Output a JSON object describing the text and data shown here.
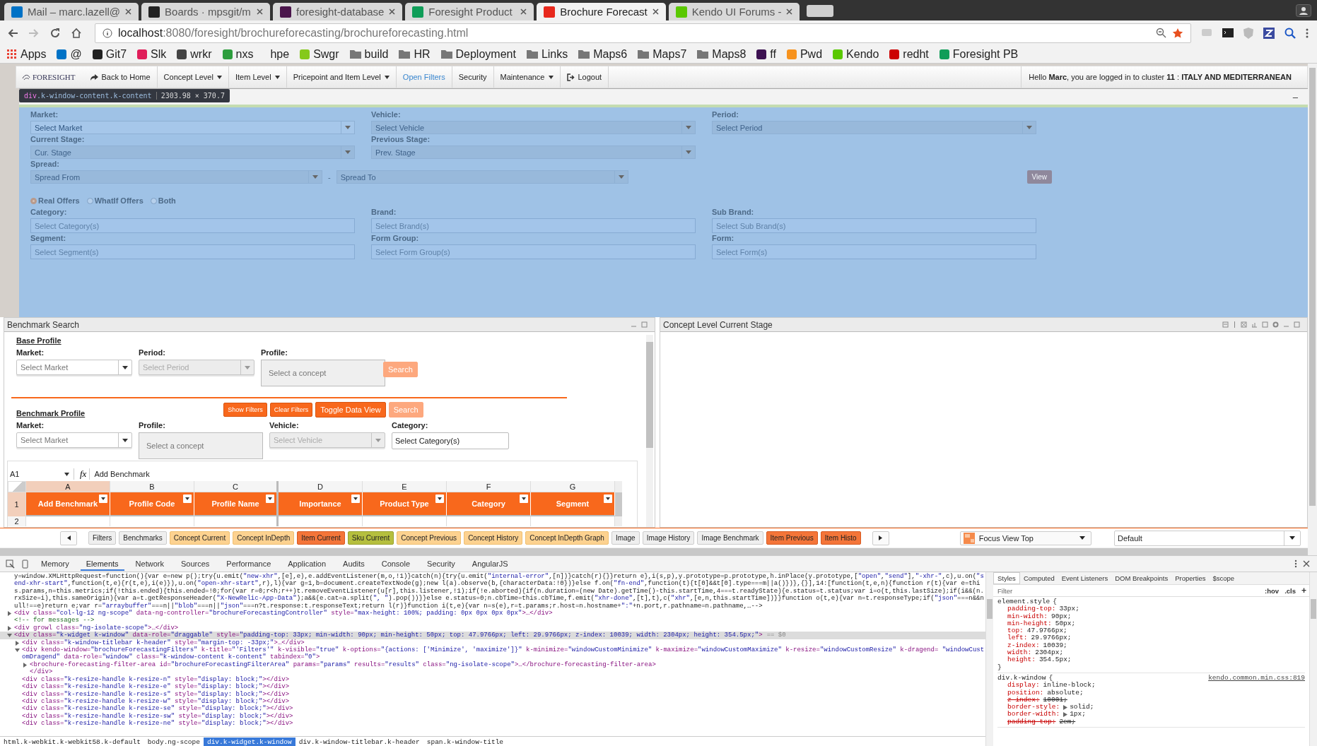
{
  "browser": {
    "tabs": [
      {
        "title": "Mail – marc.lazell@",
        "color": "#0072c6",
        "selected": false
      },
      {
        "title": "Boards · mpsgit/m",
        "color": "#222222",
        "selected": false
      },
      {
        "title": "foresight-database",
        "color": "#4a154b",
        "selected": false
      },
      {
        "title": "Foresight Product",
        "color": "#0f9d58",
        "selected": false
      },
      {
        "title": "Brochure Forecast",
        "color": "#e8281c",
        "selected": true
      },
      {
        "title": "Kendo UI Forums -",
        "color": "#5ac800",
        "selected": false
      }
    ],
    "url_host": "localhost",
    "url_path": ":8080/foresight/brochureforecasting/brochureforecasting.html",
    "bookmarks": [
      {
        "label": "Apps",
        "kind": "grid",
        "color": "#e94235"
      },
      {
        "label": "@",
        "kind": "site",
        "color": "#0072c6"
      },
      {
        "label": "Git7",
        "kind": "site",
        "color": "#222222"
      },
      {
        "label": "Slk",
        "kind": "site",
        "color": "#e01e5a"
      },
      {
        "label": "wrkr",
        "kind": "site",
        "color": "#444444"
      },
      {
        "label": "nxs",
        "kind": "site",
        "color": "#2e9e3e"
      },
      {
        "label": "hpe",
        "kind": "plain"
      },
      {
        "label": "Swgr",
        "kind": "site",
        "color": "#85c91b"
      },
      {
        "label": "build",
        "kind": "folder",
        "color": "#777777"
      },
      {
        "label": "HR",
        "kind": "folder",
        "color": "#777777"
      },
      {
        "label": "Deployment",
        "kind": "folder",
        "color": "#777777"
      },
      {
        "label": "Links",
        "kind": "folder",
        "color": "#777777"
      },
      {
        "label": "Maps6",
        "kind": "folder",
        "color": "#777777"
      },
      {
        "label": "Maps7",
        "kind": "folder",
        "color": "#777777"
      },
      {
        "label": "Maps8",
        "kind": "folder",
        "color": "#777777"
      },
      {
        "label": "ff",
        "kind": "site",
        "color": "#3d1252"
      },
      {
        "label": "Pwd",
        "kind": "site",
        "color": "#f7931e"
      },
      {
        "label": "Kendo",
        "kind": "site",
        "color": "#5ac800"
      },
      {
        "label": "redht",
        "kind": "site",
        "color": "#cc0000"
      },
      {
        "label": "Foresight PB",
        "kind": "site",
        "color": "#0f9d58"
      }
    ]
  },
  "nav": {
    "logo": "FORESIGHT",
    "items": [
      {
        "label": "Back to Home",
        "kind": "back"
      },
      {
        "label": "Concept Level",
        "kind": "menu"
      },
      {
        "label": "Item Level",
        "kind": "menu"
      },
      {
        "label": "Pricepoint and Item Level",
        "kind": "menu"
      },
      {
        "label": "Open Filters",
        "kind": "link"
      },
      {
        "label": "Security",
        "kind": "plain"
      },
      {
        "label": "Maintenance",
        "kind": "menu"
      },
      {
        "label": "Logout",
        "kind": "logout"
      }
    ],
    "greeting": "Hello **Marc**, you are logged in to cluster **11** : **ITALY AND MEDITERRANEAN**"
  },
  "inspect_tooltip": {
    "tag": "div",
    "classes": ".k-window-content.k-content",
    "size": "2303.98 × 370.7"
  },
  "filters": {
    "minimize": "–",
    "dropdowns": [
      {
        "label": "Market:",
        "placeholder": "Select Market",
        "disabled": false
      },
      {
        "label": "Vehicle:",
        "placeholder": "Select Vehicle",
        "disabled": true
      },
      {
        "label": "Period:",
        "placeholder": "Select Period",
        "disabled": true
      },
      {
        "label": "Current Stage:",
        "placeholder": "Cur. Stage",
        "disabled": true
      },
      {
        "label": "Previous Stage:",
        "placeholder": "Prev. Stage",
        "disabled": true
      }
    ],
    "spread": {
      "label": "Spread:",
      "from": "Spread From",
      "separator": "-",
      "to": "Spread To",
      "disabled": true
    },
    "view_button": "View",
    "offer_types": [
      {
        "label": "Real Offers",
        "selected": true
      },
      {
        "label": "WhatIf Offers",
        "selected": false
      },
      {
        "label": "Both",
        "selected": false
      }
    ],
    "multiselects": [
      {
        "label": "Category:",
        "placeholder": "Select Category(s)"
      },
      {
        "label": "Brand:",
        "placeholder": "Select Brand(s)"
      },
      {
        "label": "Sub Brand:",
        "placeholder": "Select Sub Brand(s)"
      },
      {
        "label": "Segment:",
        "placeholder": "Select Segment(s)"
      },
      {
        "label": "Form Group:",
        "placeholder": "Select Form Group(s)"
      },
      {
        "label": "Form:",
        "placeholder": "Select Form(s)"
      }
    ]
  },
  "benchmark": {
    "title": "Benchmark Search",
    "base_profile": {
      "heading": "Base Profile",
      "fields": [
        {
          "label": "Market:",
          "placeholder": "Select Market",
          "kind": "dropdown",
          "disabled": false
        },
        {
          "label": "Period:",
          "placeholder": "Select Period",
          "kind": "dropdown",
          "disabled": true
        },
        {
          "label": "Profile:",
          "placeholder": "Select a concept",
          "kind": "concept"
        }
      ],
      "search": {
        "label": "Search",
        "disabled": true
      }
    },
    "benchmark_profile": {
      "heading": "Benchmark Profile",
      "buttons": [
        {
          "label": "Show Filters",
          "kind": "small",
          "disabled": false
        },
        {
          "label": "Clear Filters",
          "kind": "small",
          "disabled": false
        },
        {
          "label": "Toggle Data View",
          "kind": "large",
          "disabled": false
        },
        {
          "label": "Search",
          "kind": "large",
          "disabled": true
        }
      ],
      "fields": [
        {
          "label": "Market:",
          "placeholder": "Select Market",
          "kind": "dropdown",
          "disabled": false
        },
        {
          "label": "Profile:",
          "placeholder": "Select a concept",
          "kind": "concept"
        },
        {
          "label": "Vehicle:",
          "placeholder": "Select Vehicle",
          "kind": "dropdown",
          "disabled": true
        },
        {
          "label": "Category:",
          "placeholder": "Select Category(s)",
          "kind": "multi"
        }
      ]
    },
    "sheet": {
      "cell_ref": "A1",
      "fx": "fx",
      "formula": "Add Benchmark",
      "columns": [
        {
          "label": "A",
          "selected": true
        },
        {
          "label": "B",
          "selected": false
        },
        {
          "label": "C",
          "selected": false
        },
        {
          "label": "D",
          "selected": false
        },
        {
          "label": "E",
          "selected": false
        },
        {
          "label": "F",
          "selected": false
        },
        {
          "label": "G",
          "selected": false
        }
      ],
      "header_row": "1",
      "headers": [
        "Add Benchmark",
        "Profile Code",
        "Profile Name",
        "Importance",
        "Product Type",
        "Category",
        "Segment"
      ],
      "next_row": "2"
    }
  },
  "concept_panel": {
    "title": "Concept Level Current Stage"
  },
  "bottom_bar": {
    "tabs": [
      {
        "label": "Filters",
        "kind": "plain"
      },
      {
        "label": "Benchmarks",
        "kind": "plain"
      },
      {
        "label": "Concept Current",
        "kind": "concept"
      },
      {
        "label": "Concept InDepth",
        "kind": "concept"
      },
      {
        "label": "Item Current",
        "kind": "item"
      },
      {
        "label": "Sku Current",
        "kind": "sku"
      },
      {
        "label": "Concept Previous",
        "kind": "concept"
      },
      {
        "label": "Concept History",
        "kind": "concept"
      },
      {
        "label": "Concept InDepth Graph",
        "kind": "concept"
      },
      {
        "label": "Image",
        "kind": "plain"
      },
      {
        "label": "Image History",
        "kind": "plain"
      },
      {
        "label": "Image Benchmark",
        "kind": "plain"
      },
      {
        "label": "Item Previous",
        "kind": "item"
      },
      {
        "label": "Item Histo",
        "kind": "item"
      }
    ],
    "focus_view": "Focus View Top",
    "layout": "Default"
  },
  "devtools": {
    "tabs": [
      {
        "label": "Memory",
        "selected": false
      },
      {
        "label": "Elements",
        "selected": true
      },
      {
        "label": "Network",
        "selected": false
      },
      {
        "label": "Sources",
        "selected": false
      },
      {
        "label": "Performance",
        "selected": false
      },
      {
        "label": "Application",
        "selected": false
      },
      {
        "label": "Audits",
        "selected": false
      },
      {
        "label": "Console",
        "selected": false
      },
      {
        "label": "Security",
        "selected": false
      },
      {
        "label": "AngularJS",
        "selected": false
      }
    ],
    "dom_tree": [
      {
        "kind": "script",
        "selected": false,
        "text": "y=window.XMLHttpRequest=function(){var e=new p();try{u.emit(\"new-xhr\",[e],e),e.addEventListener(m,o,!1)}catch(n){try{u.emit(\"internal-error\",[n])}catch(r){}}return e},i(s,p),y.prototype=p.prototype,h.inPlace(y.prototype,[\"open\",\"send\"],\"-xhr-\",c),u.on(\"send-xhr-start\",function(t,e){r(t,e),i(e)}),u.on(\"open-xhr-start\",r),l){var g=1,b=document.createTextNode(g);new l(a).observe(b,{characterData:!0})}else f.on(\"fn-end\",function(t){t[0]&&t[0].type===m||a()})},{}],14:[function(t,e,n){function r(t){var e=this.params,n=this.metrics;if(!this.ended){this.ended=!0;for(var r=0;r<h;r++)t.removeEventListener(u[r],this.listener,!1);if(!e.aborted){if(n.duration=(new Date).getTime()-this.startTime,4===t.readyState){e.status=t.status;var i=o(t,this.lastSize);if(i&&(n.rxSize=i),this.sameOrigin){var a=t.getResponseHeader(\"X-NewRelic-App-Data\");a&&(e.cat=a.split(\", \").pop())}}else e.status=0;n.cbTime=this.cbTime,f.emit(\"xhr-done\",[t],t),c(\"xhr\",[e,n,this.startTime])}}function o(t,e){var n=t.responseType;if(\"json\"===n&&null!==e)return e;var r=\"arraybuffer\"===n||\"blob\"===n||\"json\"===n?t.response:t.responseText;return l(r)}function i(t,e){var n=s(e),r=t.params;r.host=n.hostname+\":\"+n.port,r.pathname=n.pathname,…-->"
      },
      {
        "kind": "element",
        "selected": false,
        "expanded": false,
        "text": "<div class=\"col-lg-12 ng-scope\" data-ng-controller=\"brochureForecastingController\" style=\"max-height: 100%; padding: 0px 0px 0px 0px\">…</div>"
      },
      {
        "kind": "comment",
        "selected": false,
        "text": "<!-- for messages -->"
      },
      {
        "kind": "element",
        "selected": false,
        "expanded": false,
        "text": "<div growl class=\"ng-isolate-scope\">…</div>"
      },
      {
        "kind": "element",
        "selected": true,
        "expanded": true,
        "marker": "== $0",
        "text": "<div class=\"k-widget k-window\" data-role=\"draggable\" style=\"padding-top: 33px; min-width: 90px; min-height: 50px; top: 47.9766px; left: 29.9766px; z-index: 10039; width: 2304px; height: 354.5px;\">",
        "children": [
          {
            "kind": "element",
            "selected": false,
            "expanded": false,
            "text": "<div class=\"k-window-titlebar k-header\" style=\"margin-top: -33px;\">…</div>"
          },
          {
            "kind": "element",
            "selected": false,
            "expanded": true,
            "text": "<div kendo-window=\"brochureForecastingFilters\" k-title=\"'Filters'\" k-visible=\"true\" k-options=\"{actions: ['Minimize', 'maximize']}\" k-minimize=\"windowCustomMinimize\" k-maximize=\"windowCustomMaximize\" k-resize=\"windowCustomResize\" k-dragend= \"windowCustomDragend\" data-role=\"window\" class=\"k-window-content k-content\" tabindex=\"0\">",
            "children": [
              {
                "kind": "element",
                "selected": false,
                "expanded": false,
                "text": "<brochure-forecasting-filter-area id=\"brochureForecastingFilterArea\" params=\"params\" results=\"results\" class=\"ng-isolate-scope\">…</brochure-forecasting-filter-area>"
              },
              {
                "kind": "element",
                "selected": false,
                "text": "</div>"
              }
            ]
          },
          {
            "kind": "element",
            "selected": false,
            "text": "<div class=\"k-resize-handle k-resize-n\" style=\"display: block;\"></div>"
          },
          {
            "kind": "element",
            "selected": false,
            "text": "<div class=\"k-resize-handle k-resize-e\" style=\"display: block;\"></div>"
          },
          {
            "kind": "element",
            "selected": false,
            "text": "<div class=\"k-resize-handle k-resize-s\" style=\"display: block;\"></div>"
          },
          {
            "kind": "element",
            "selected": false,
            "text": "<div class=\"k-resize-handle k-resize-w\" style=\"display: block;\"></div>"
          },
          {
            "kind": "element",
            "selected": false,
            "text": "<div class=\"k-resize-handle k-resize-se\" style=\"display: block;\"></div>"
          },
          {
            "kind": "element",
            "selected": false,
            "text": "<div class=\"k-resize-handle k-resize-sw\" style=\"display: block;\"></div>"
          },
          {
            "kind": "element",
            "selected": false,
            "text": "<div class=\"k-resize-handle k-resize-ne\" style=\"display: block;\"></div>"
          }
        ]
      }
    ],
    "breadcrumbs": [
      {
        "label": "html.k-webkit.k-webkit58.k-default",
        "selected": false
      },
      {
        "label": "body.ng-scope",
        "selected": false
      },
      {
        "label": "div.k-widget.k-window",
        "selected": true
      },
      {
        "label": "div.k-window-titlebar.k-header",
        "selected": false
      },
      {
        "label": "span.k-window-title",
        "selected": false
      }
    ],
    "styles": {
      "tabs": [
        {
          "label": "Styles",
          "selected": true
        },
        {
          "label": "Computed",
          "selected": false
        },
        {
          "label": "Event Listeners",
          "selected": false
        },
        {
          "label": "DOM Breakpoints",
          "selected": false
        },
        {
          "label": "Properties",
          "selected": false
        },
        {
          "label": "$scope",
          "selected": false
        }
      ],
      "filter_placeholder": "Filter",
      "hov": ":hov",
      "cls": ".cls",
      "add": "+",
      "rules": [
        {
          "selector": "element.style",
          "open": "{",
          "close": "}",
          "props": [
            {
              "name": "padding-top:",
              "value": "33px;",
              "struck": false
            },
            {
              "name": "min-width:",
              "value": "90px;",
              "struck": false
            },
            {
              "name": "min-height:",
              "value": "50px;",
              "struck": false
            },
            {
              "name": "top:",
              "value": "47.9766px;",
              "struck": false
            },
            {
              "name": "left:",
              "value": "29.9766px;",
              "struck": false
            },
            {
              "name": "z-index:",
              "value": "10039;",
              "struck": false
            },
            {
              "name": "width:",
              "value": "2304px;",
              "struck": false
            },
            {
              "name": "height:",
              "value": "354.5px;",
              "struck": false
            }
          ]
        },
        {
          "selector": "div.k-window",
          "source": "kendo.common.min.css:819",
          "open": "{",
          "props": [
            {
              "name": "display:",
              "value": "inline-block;",
              "struck": false
            },
            {
              "name": "position:",
              "value": "absolute;",
              "struck": false
            },
            {
              "name": "z-index:",
              "value": "10001;",
              "struck": true
            },
            {
              "name": "border-style:",
              "value": "solid;",
              "struck": false,
              "expandable": true
            },
            {
              "name": "border-width:",
              "value": "1px;",
              "struck": false,
              "expandable": true
            },
            {
              "name": "padding-top:",
              "value": "2em;",
              "struck": true
            }
          ]
        }
      ]
    }
  }
}
